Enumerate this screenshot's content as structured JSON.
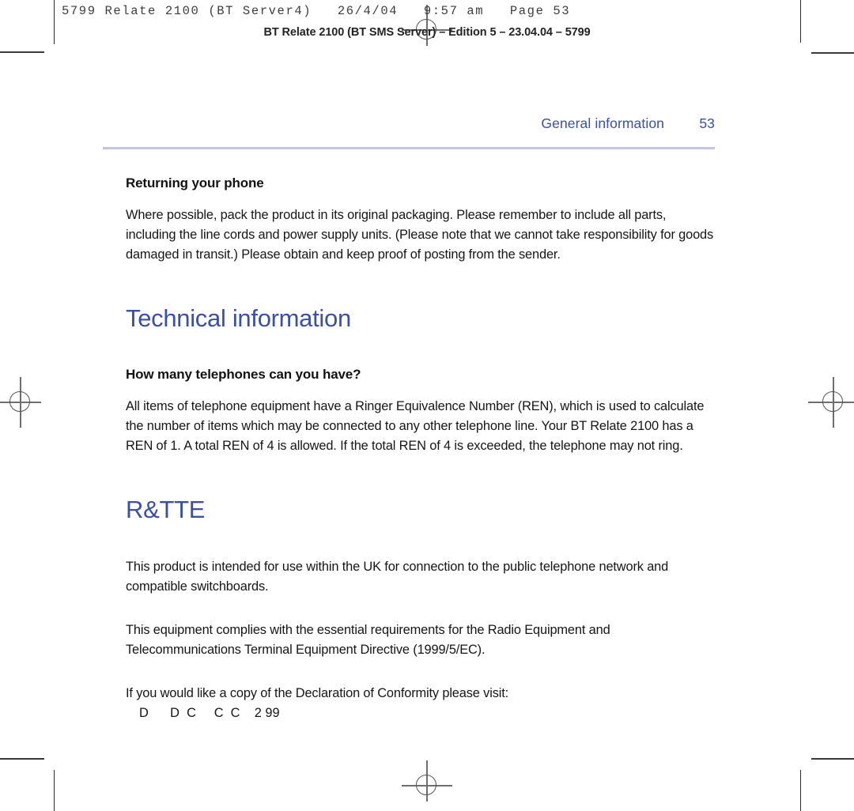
{
  "scan_header": {
    "text": "5799 Relate 2100 (BT Server4)   26/4/04   9:57 am   Page 53"
  },
  "document_footer_line": {
    "text": "BT Relate 2100 (BT SMS Server) – Edition 5 – 23.04.04 – 5799"
  },
  "running_head": {
    "title": "General information",
    "page_number": "53",
    "accent_color": "#3b4fa4",
    "rule_color": "#c4c5e4"
  },
  "sections": {
    "returning": {
      "heading": "Returning your phone",
      "paragraph": "Where possible, pack the product in its original packaging. Please remember to include all parts, including the line cords and power supply units. (Please note that we cannot take responsibility for goods damaged in transit.) Please obtain and keep proof of posting from the sender."
    },
    "technical": {
      "heading": "Technical information",
      "sub_heading": "How many telephones can you have?",
      "paragraph": "All items of telephone equipment have a Ringer Equivalence Number (REN), which is used to calculate the number of items which may be connected to any other telephone line. Your BT Relate 2100 has a REN of 1. A total REN of 4 is allowed. If the total REN of 4 is exceeded, the telephone may not ring."
    },
    "rtte": {
      "heading": "R&TTE",
      "paragraph_1": "This product is intended for use within the UK for connection to the public telephone network and compatible switchboards.",
      "paragraph_2": "This equipment complies with the essential requirements for the Radio Equipment and Telecommunications Terminal Equipment Directive (1999/5/EC).",
      "paragraph_3": "If you would like a copy of the Declaration of Conformity please visit:",
      "degraded_line": "D      D  C     C  C    2 99"
    }
  },
  "print_marks": {
    "registration_icon": "registration-crosshair",
    "crop_icon": "crop-mark",
    "mark_color": "#6e6e6e"
  }
}
